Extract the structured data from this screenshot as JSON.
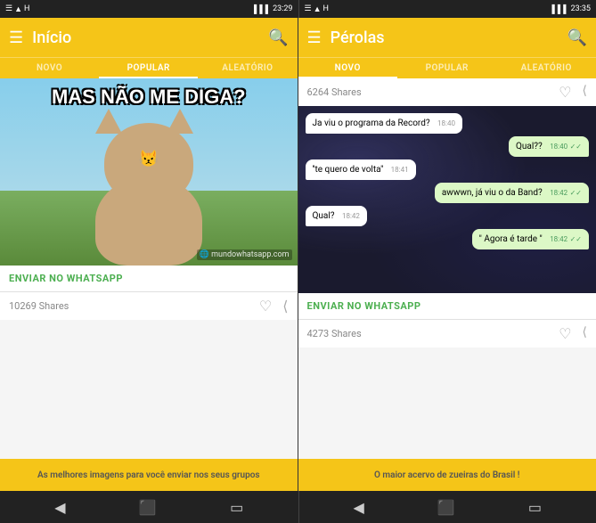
{
  "left": {
    "status": {
      "time": "23:29",
      "icons": "☰ ▲ H ▌▌▌"
    },
    "appbar": {
      "menu_label": "☰",
      "title": "Início",
      "search_label": "🔍"
    },
    "tabs": [
      {
        "label": "NOVO",
        "active": false
      },
      {
        "label": "POPULAR",
        "active": true
      },
      {
        "label": "ALEATÓRIO",
        "active": false
      }
    ],
    "post": {
      "meme_text": "MAS NÃO ME DIGA?",
      "watermark": "🌐 mundowhatsapp.com",
      "send_label": "ENVIAR NO WHATSAPP",
      "shares_count": "10269 Shares"
    },
    "bottom_text": "As melhores imagens para você enviar nos seus grupos"
  },
  "right": {
    "status": {
      "time": "23:35",
      "icons": "☰ ▲ H ▌▌▌"
    },
    "appbar": {
      "menu_label": "☰",
      "title": "Pérolas",
      "search_label": "🔍"
    },
    "tabs": [
      {
        "label": "NOVO",
        "active": true
      },
      {
        "label": "POPULAR",
        "active": false
      },
      {
        "label": "ALEATÓRIO",
        "active": false
      }
    ],
    "post": {
      "shares_top": "6264 Shares",
      "chat": [
        {
          "dir": "received",
          "text": "Ja viu o programa da Record?",
          "time": "18:40",
          "check": ""
        },
        {
          "dir": "sent",
          "text": "Qual??",
          "time": "18:40",
          "check": "✓✓"
        },
        {
          "dir": "received",
          "text": "''te quero de volta''",
          "time": "18:41",
          "check": ""
        },
        {
          "dir": "sent",
          "text": "awwwn, já viu o da Band?",
          "time": "18:42",
          "check": "✓✓"
        },
        {
          "dir": "received",
          "text": "Qual?",
          "time": "18:42",
          "check": ""
        },
        {
          "dir": "sent",
          "text": "\" Agora é tarde \"",
          "time": "18:42",
          "check": "✓✓"
        }
      ],
      "send_label": "ENVIAR NO WHATSAPP",
      "shares_bottom": "4273 Shares"
    },
    "bottom_text": "O maior acervo de zueiras do Brasil !"
  },
  "nav": {
    "back": "◀",
    "home": "⬛",
    "recent": "▭"
  }
}
